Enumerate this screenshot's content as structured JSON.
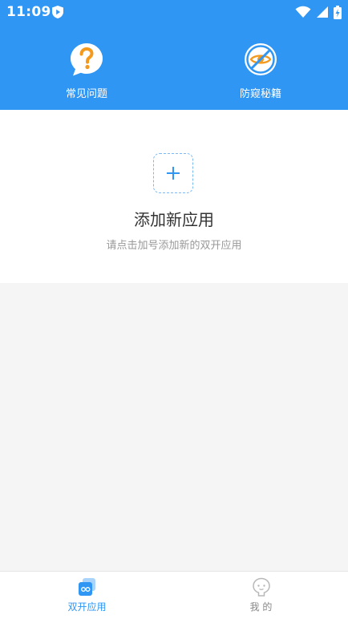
{
  "status_bar": {
    "time": "11:09"
  },
  "features": [
    {
      "label": "常见问题",
      "icon": "question-bubble-icon"
    },
    {
      "label": "防窥秘籍",
      "icon": "no-peek-eye-icon"
    }
  ],
  "add_app": {
    "title": "添加新应用",
    "subtitle": "请点击加号添加新的双开应用",
    "plus_icon": "plus-icon"
  },
  "bottom_nav": {
    "items": [
      {
        "label": "双开应用",
        "icon": "dual-apps-icon",
        "active": true
      },
      {
        "label": "我 的",
        "icon": "profile-face-icon",
        "active": false
      }
    ]
  },
  "colors": {
    "primary": "#2f96f3",
    "accent_orange": "#f39a1e",
    "page_bg": "#f5f5f5",
    "text_dark": "#333333",
    "text_muted": "#999999",
    "nav_inactive": "#888888"
  }
}
